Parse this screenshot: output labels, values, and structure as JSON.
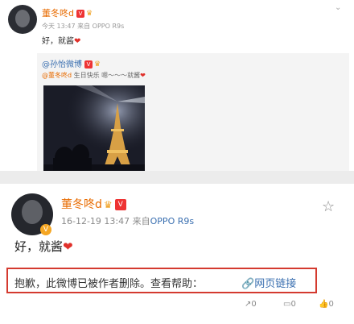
{
  "post1": {
    "author": "董冬咚d",
    "meta": "今天 13:47 来自 OPPO R9s",
    "text": "好，就酱",
    "heart": "❤"
  },
  "repost": {
    "author": "@孙怡微博",
    "mention": "@董冬咚d",
    "text": " 生日快乐 嗯～～～就酱",
    "heart": "❤"
  },
  "post2": {
    "author": "董冬咚d",
    "time": "16-12-19 13:47",
    "source_prefix": " 来自",
    "source": "OPPO R9s",
    "text": "好，就酱",
    "heart": "❤",
    "verified_badge": "V",
    "notice": "抱歉，此微博已被作者删除。查看帮助：",
    "link_icon": "🔗",
    "link": "网页链接"
  },
  "actions": {
    "repost": "↗0",
    "comment": "▭0",
    "like": "👍0"
  },
  "colors": {
    "name": "#e86b00",
    "link": "#3a6fb0",
    "highlight_border": "#d43a2f"
  }
}
